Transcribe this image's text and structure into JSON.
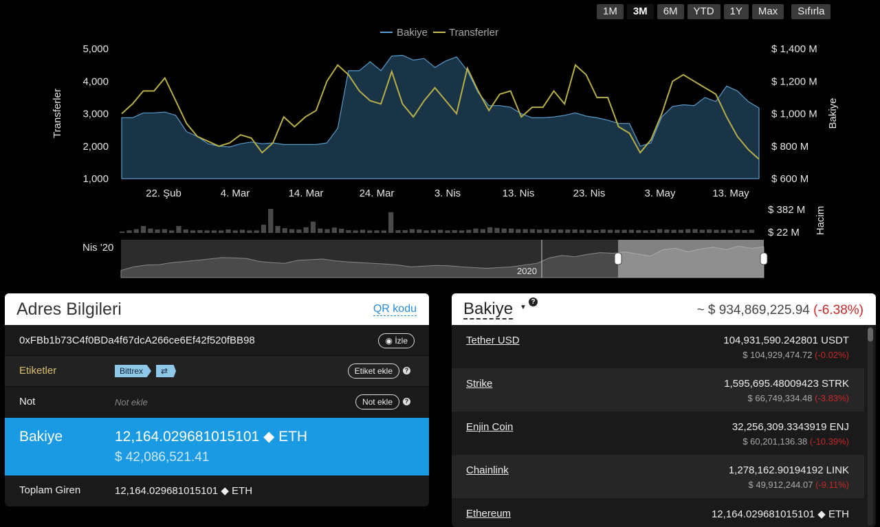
{
  "range_buttons": [
    "1M",
    "3M",
    "6M",
    "YTD",
    "1Y",
    "Max"
  ],
  "reset_label": "Sıfırla",
  "chart_data": {
    "type": "line",
    "legend": [
      "Bakiye",
      "Transferler"
    ],
    "left_axis": {
      "label": "Transferler",
      "ticks": [
        "5,000",
        "4,000",
        "3,000",
        "2,000",
        "1,000"
      ],
      "range": [
        1000,
        5000
      ]
    },
    "right_axis": {
      "label": "Bakiye",
      "ticks": [
        "$ 1,400 M",
        "$ 1,200 M",
        "$ 1,000 M",
        "$ 800 M",
        "$ 600 M"
      ],
      "range": [
        600,
        1400
      ]
    },
    "x_ticks": [
      "22. Şub",
      "4. Mar",
      "14. Mar",
      "24. Mar",
      "3. Nis",
      "13. Nis",
      "23. Nis",
      "3. May",
      "13. May"
    ],
    "series": [
      {
        "name": "Bakiye",
        "color": "#5aa0d8",
        "values": [
          975,
          975,
          1005,
          1005,
          1010,
          990,
          890,
          860,
          815,
          800,
          795,
          815,
          825,
          815,
          820,
          810,
          810,
          810,
          810,
          820,
          910,
          1265,
          1265,
          1320,
          1265,
          1355,
          1360,
          1330,
          1340,
          1285,
          1325,
          1350,
          1265,
          1130,
          1050,
          1050,
          1040,
          1000,
          975,
          975,
          980,
          990,
          1005,
          985,
          975,
          960,
          940,
          940,
          800,
          820,
          980,
          1045,
          1055,
          1050,
          1100,
          1075,
          1170,
          1140,
          1075,
          1035
        ]
      },
      {
        "name": "Transferler",
        "color": "#c8c050",
        "values": [
          3000,
          3300,
          3700,
          3700,
          4100,
          3400,
          2700,
          2300,
          2150,
          2000,
          2100,
          2350,
          2250,
          1800,
          2100,
          2900,
          2600,
          2900,
          3100,
          4000,
          4500,
          4200,
          3700,
          3400,
          3300,
          4300,
          3300,
          2900,
          3400,
          3800,
          3400,
          3000,
          4400,
          3700,
          3100,
          3600,
          3700,
          2900,
          3200,
          3200,
          3700,
          3300,
          4500,
          4200,
          3500,
          3500,
          2600,
          2400,
          1800,
          2200,
          3000,
          4000,
          4200,
          4000,
          3800,
          3600,
          2900,
          2300,
          1900,
          1600
        ]
      }
    ],
    "volume": {
      "label": "Hacim",
      "ticks": [
        "$ 382 M",
        "$ 22 M"
      ],
      "values": [
        22,
        40,
        60,
        110,
        70,
        55,
        60,
        40,
        110,
        55,
        40,
        45,
        40,
        40,
        40,
        55,
        40,
        50,
        40,
        40,
        130,
        382,
        110,
        75,
        60,
        55,
        90,
        180,
        70,
        60,
        85,
        65,
        45,
        40,
        50,
        40,
        40,
        40,
        330,
        45,
        45,
        60,
        55,
        40,
        45,
        50,
        40,
        45,
        40,
        50,
        70,
        60,
        90,
        80,
        70,
        70,
        60,
        60,
        60,
        55,
        60,
        55,
        55,
        55,
        55,
        50,
        50,
        45,
        55,
        50,
        50,
        50,
        50,
        45,
        40,
        45,
        60,
        55,
        50,
        50,
        60,
        60,
        50,
        55,
        50,
        50,
        45,
        55,
        45,
        50
      ]
    },
    "navigator": {
      "start_label": "Nis '20",
      "year_label": "2020",
      "values": [
        20,
        30,
        35,
        36,
        42,
        45,
        48,
        52,
        56,
        55,
        53,
        45,
        42,
        40,
        48,
        50,
        52,
        47,
        44,
        42,
        40,
        38,
        35,
        30,
        32,
        34,
        33,
        30,
        28,
        26,
        28,
        30,
        35,
        40,
        55,
        62,
        58,
        65,
        70,
        68,
        72,
        66,
        60,
        78,
        82,
        72,
        80,
        85,
        78,
        88,
        82,
        86
      ]
    }
  },
  "address_panel": {
    "title": "Adres Bilgileri",
    "qr_link": "QR kodu",
    "address": "0xFBb1b73C4f0BDa4f67dcA266ce6Ef42f520fBB98",
    "watch_label": "İzle",
    "tags_label": "Etiketler",
    "tag1": "Bittrex",
    "tag2": "⇄",
    "add_tag_label": "Etiket ekle",
    "note_label": "Not",
    "note_placeholder": "Not ekle",
    "add_note_label": "Not ekle",
    "balance_label": "Bakiye",
    "balance_eth": "12,164.029681015101",
    "balance_unit": "ETH",
    "balance_usd": "$ 42,086,521.41",
    "total_in_label": "Toplam Giren",
    "total_in_value": "12,164.029681015101",
    "total_in_unit": "ETH"
  },
  "tokens_panel": {
    "title": "Bakiye",
    "help": "?",
    "total_usd": "~ $ 934,869,225.94",
    "total_change": "(-6.38%)",
    "tokens": [
      {
        "name": "Tether USD",
        "amount": "104,931,590.242801 USDT",
        "usd": "$ 104,929,474.72",
        "change": "(-0.02%)"
      },
      {
        "name": "Strike",
        "amount": "1,595,695.48009423 STRK",
        "usd": "$ 66,749,334.48",
        "change": "(-3.83%)"
      },
      {
        "name": "Enjin Coin",
        "amount": "32,256,309.3343919 ENJ",
        "usd": "$ 60,201,136.38",
        "change": "(-10.39%)"
      },
      {
        "name": "Chainlink",
        "amount": "1,278,162.90194192 LINK",
        "usd": "$ 49,912,244.07",
        "change": "(-9.11%)"
      },
      {
        "name": "Ethereum",
        "amount": "12,164.029681015101 ◆ ETH",
        "usd": "",
        "change": ""
      }
    ]
  }
}
